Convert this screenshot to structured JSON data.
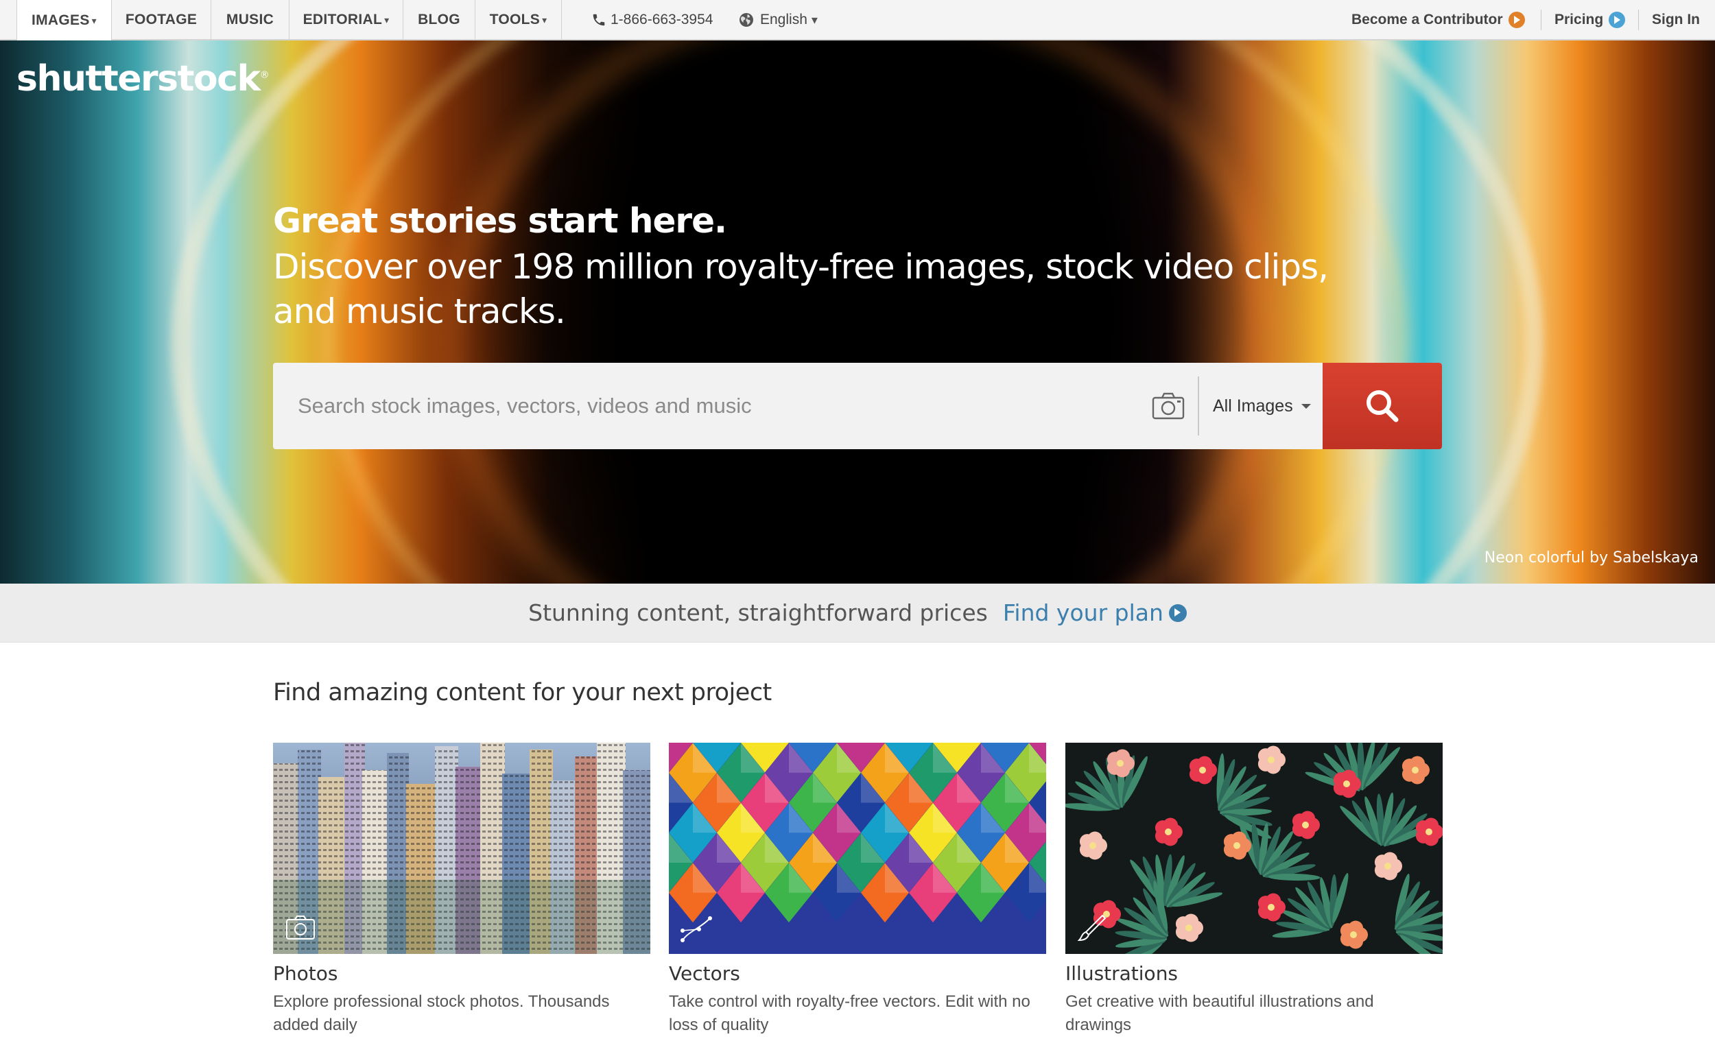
{
  "nav": {
    "tabs": [
      {
        "label": "IMAGES",
        "dropdown": true,
        "active": true
      },
      {
        "label": "FOOTAGE",
        "dropdown": false
      },
      {
        "label": "MUSIC",
        "dropdown": false
      },
      {
        "label": "EDITORIAL",
        "dropdown": true
      },
      {
        "label": "BLOG",
        "dropdown": false
      },
      {
        "label": "TOOLS",
        "dropdown": true
      }
    ],
    "dropdown_glyph": "▾",
    "phone": "1-866-663-3954",
    "language": "English",
    "become_contributor": "Become a Contributor",
    "pricing": "Pricing",
    "sign_in": "Sign In"
  },
  "hero": {
    "logo": "shutterstock",
    "logo_mark": "®",
    "headline": "Great stories start here.",
    "subheadline": "Discover over 198 million royalty-free images, stock video clips, and music tracks.",
    "search": {
      "placeholder": "Search stock images, vectors, videos and music",
      "category": "All Images"
    },
    "credit": "Neon colorful by Sabelskaya"
  },
  "promo": {
    "text": "Stunning content, straightforward prices",
    "link": "Find your plan"
  },
  "content": {
    "title": "Find amazing content for your next project",
    "cards": [
      {
        "title": "Photos",
        "description": "Explore professional stock photos. Thousands added daily"
      },
      {
        "title": "Vectors",
        "description": "Take control with royalty-free vectors. Edit with no loss of quality"
      },
      {
        "title": "Illustrations",
        "description": "Get creative with beautiful illustrations and drawings"
      }
    ]
  },
  "colors": {
    "search_button": "#c9392a",
    "link_blue": "#3b7fad",
    "contributor_arrow": "#e0802a",
    "pricing_arrow": "#4aa3d4"
  },
  "icons": {
    "phone": "phone-icon",
    "globe": "globe-icon",
    "camera": "camera-icon",
    "search": "search-icon"
  }
}
